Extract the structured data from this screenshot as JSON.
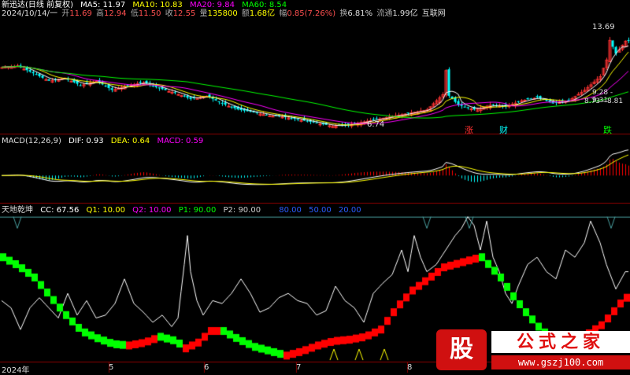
{
  "header": {
    "stock": "新迅达(日线 前复权)",
    "date": "2024/10/14/一",
    "ohlc": [
      {
        "label": "开",
        "value": "11.69"
      },
      {
        "label": "高",
        "value": "12.94"
      },
      {
        "label": "低",
        "value": "11.50"
      },
      {
        "label": "收",
        "value": "12.55"
      }
    ],
    "volume": {
      "label": "量",
      "value": "135800"
    },
    "amount": {
      "label": "额",
      "value": "1.68亿"
    },
    "change": {
      "label": "幅",
      "value": "0.85(7.26%)"
    },
    "turnover": {
      "label": "换",
      "value": "6.81%"
    },
    "float": {
      "label": "流通",
      "value": "1.99亿"
    },
    "sector": "互联网",
    "ma": [
      {
        "label": "MA5: 11.97",
        "color": "#ffffff"
      },
      {
        "label": "MA10: 10.83",
        "color": "#ffff00"
      },
      {
        "label": "MA20: 9.84",
        "color": "#ff00ff"
      },
      {
        "label": "MA60: 8.54",
        "color": "#00ff00"
      }
    ]
  },
  "macd_header": {
    "title": "MACD(12,26,9)",
    "dif": "DIF: 0.93",
    "dea": "DEA: 0.64",
    "macd": "MACD: 0.59"
  },
  "tdqk_header": {
    "title": "天地乾坤",
    "cc": "CC: 67.56",
    "q1": "Q1: 10.00",
    "q2": "Q2: 10.00",
    "p1": "P1: 90.00",
    "p2": "P2: 90.00",
    "l80": "80.00",
    "l50": "50.00",
    "l20": "20.00"
  },
  "annotations": {
    "high": "13.69",
    "low": "6.74",
    "r1": "9.28 - 9.31",
    "r2": "8.73 - 8.81",
    "zhang": "涨",
    "cai": "财",
    "die": "跌"
  },
  "xaxis": [
    "2024年",
    "5",
    "6",
    "7",
    "8"
  ],
  "watermark": {
    "logo": "股",
    "name": "公式之家",
    "url": "www.gszj100.com"
  },
  "colors": {
    "up": "#ff3232",
    "down": "#00ffff",
    "bg": "#000000",
    "grid": "#8b0000",
    "ma5": "#ffffff",
    "ma10": "#ffff00",
    "ma20": "#ff00ff",
    "ma60": "#00ff00",
    "green": "#00ff00",
    "red": "#ff0000"
  },
  "chart_data": {
    "type": "candlestick",
    "price_keypoints": [
      [
        0,
        10.8
      ],
      [
        5,
        10.9
      ],
      [
        10,
        10.4
      ],
      [
        15,
        9.9
      ],
      [
        20,
        10.1
      ],
      [
        25,
        9.6
      ],
      [
        30,
        9.9
      ],
      [
        35,
        9.3
      ],
      [
        40,
        9.6
      ],
      [
        45,
        9.8
      ],
      [
        50,
        9.4
      ],
      [
        55,
        9.1
      ],
      [
        60,
        8.7
      ],
      [
        65,
        8.9
      ],
      [
        70,
        8.4
      ],
      [
        75,
        8.0
      ],
      [
        80,
        7.8
      ],
      [
        85,
        7.6
      ],
      [
        90,
        7.5
      ],
      [
        95,
        7.3
      ],
      [
        100,
        7.1
      ],
      [
        105,
        6.9
      ],
      [
        110,
        7.0
      ],
      [
        115,
        7.2
      ],
      [
        120,
        7.4
      ],
      [
        125,
        7.6
      ],
      [
        130,
        7.8
      ],
      [
        135,
        8.0
      ],
      [
        140,
        9.0
      ],
      [
        141,
        10.6
      ],
      [
        142,
        8.9
      ],
      [
        145,
        8.3
      ],
      [
        150,
        8.0
      ],
      [
        155,
        8.3
      ],
      [
        160,
        8.2
      ],
      [
        165,
        8.6
      ],
      [
        170,
        8.8
      ],
      [
        175,
        8.4
      ],
      [
        180,
        8.6
      ],
      [
        185,
        9.3
      ],
      [
        190,
        10.2
      ],
      [
        192,
        11.3
      ],
      [
        193,
        12.6
      ],
      [
        195,
        11.7
      ],
      [
        198,
        12.55
      ]
    ],
    "cc_keypoints": [
      [
        0,
        40
      ],
      [
        3,
        35
      ],
      [
        6,
        20
      ],
      [
        9,
        35
      ],
      [
        12,
        42
      ],
      [
        15,
        35
      ],
      [
        18,
        28
      ],
      [
        21,
        45
      ],
      [
        24,
        30
      ],
      [
        27,
        40
      ],
      [
        30,
        28
      ],
      [
        33,
        30
      ],
      [
        36,
        38
      ],
      [
        39,
        55
      ],
      [
        42,
        38
      ],
      [
        45,
        32
      ],
      [
        48,
        25
      ],
      [
        51,
        30
      ],
      [
        54,
        22
      ],
      [
        56,
        28
      ],
      [
        58,
        65
      ],
      [
        59,
        85
      ],
      [
        60,
        60
      ],
      [
        62,
        40
      ],
      [
        64,
        30
      ],
      [
        67,
        40
      ],
      [
        70,
        38
      ],
      [
        73,
        45
      ],
      [
        76,
        55
      ],
      [
        79,
        45
      ],
      [
        82,
        32
      ],
      [
        85,
        35
      ],
      [
        88,
        42
      ],
      [
        91,
        45
      ],
      [
        94,
        40
      ],
      [
        97,
        38
      ],
      [
        100,
        30
      ],
      [
        103,
        33
      ],
      [
        106,
        50
      ],
      [
        109,
        40
      ],
      [
        112,
        35
      ],
      [
        115,
        25
      ],
      [
        118,
        45
      ],
      [
        121,
        52
      ],
      [
        124,
        58
      ],
      [
        127,
        75
      ],
      [
        129,
        60
      ],
      [
        131,
        85
      ],
      [
        133,
        70
      ],
      [
        135,
        60
      ],
      [
        138,
        65
      ],
      [
        141,
        75
      ],
      [
        144,
        85
      ],
      [
        146,
        90
      ],
      [
        148,
        98
      ],
      [
        150,
        92
      ],
      [
        152,
        75
      ],
      [
        154,
        95
      ],
      [
        156,
        70
      ],
      [
        158,
        60
      ],
      [
        160,
        45
      ],
      [
        162,
        38
      ],
      [
        164,
        50
      ],
      [
        167,
        65
      ],
      [
        170,
        70
      ],
      [
        173,
        60
      ],
      [
        176,
        55
      ],
      [
        179,
        75
      ],
      [
        182,
        70
      ],
      [
        185,
        80
      ],
      [
        187,
        95
      ],
      [
        190,
        80
      ],
      [
        192,
        65
      ],
      [
        195,
        48
      ],
      [
        198,
        60
      ]
    ],
    "main_keypoints": [
      [
        0,
        70
      ],
      [
        5,
        64
      ],
      [
        10,
        56
      ],
      [
        15,
        43
      ],
      [
        20,
        30
      ],
      [
        25,
        19
      ],
      [
        30,
        14
      ],
      [
        35,
        10
      ],
      [
        40,
        9
      ],
      [
        45,
        11
      ],
      [
        50,
        15
      ],
      [
        55,
        12
      ],
      [
        58,
        7
      ],
      [
        62,
        11
      ],
      [
        66,
        19
      ],
      [
        70,
        19
      ],
      [
        75,
        13
      ],
      [
        80,
        8
      ],
      [
        85,
        5
      ],
      [
        90,
        2
      ],
      [
        95,
        5
      ],
      [
        100,
        9
      ],
      [
        105,
        12
      ],
      [
        110,
        13
      ],
      [
        115,
        15
      ],
      [
        120,
        20
      ],
      [
        125,
        35
      ],
      [
        130,
        47
      ],
      [
        135,
        55
      ],
      [
        140,
        63
      ],
      [
        145,
        66
      ],
      [
        150,
        69
      ],
      [
        152,
        70
      ],
      [
        155,
        63
      ],
      [
        158,
        56
      ],
      [
        162,
        43
      ],
      [
        166,
        32
      ],
      [
        170,
        22
      ],
      [
        173,
        16
      ],
      [
        176,
        14
      ],
      [
        180,
        14
      ],
      [
        185,
        16
      ],
      [
        190,
        23
      ],
      [
        193,
        30
      ],
      [
        196,
        38
      ],
      [
        198,
        42
      ]
    ],
    "ranges": {
      "price": [
        6.5,
        14.0
      ],
      "macd": [
        -1.0,
        1.2
      ],
      "tdqk": [
        0,
        100
      ]
    }
  }
}
